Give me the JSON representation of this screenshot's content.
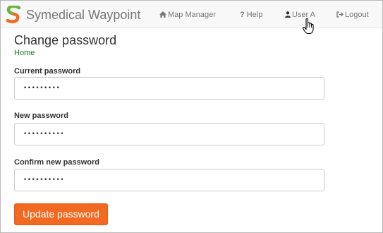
{
  "header": {
    "brand": "Symedical Waypoint",
    "logo_icon": "symedical-s-logo",
    "nav": [
      {
        "label": "Map Manager",
        "icon": "home-icon"
      },
      {
        "label": "Help",
        "icon": "question-icon"
      },
      {
        "label": "User A",
        "icon": "user-icon"
      },
      {
        "label": "Logout",
        "icon": "logout-icon"
      }
    ]
  },
  "page": {
    "title": "Change password",
    "breadcrumb": "Home"
  },
  "form": {
    "current_label": "Current password",
    "current_value": "•••••••••",
    "new_label": "New password",
    "new_value": "••••••••••",
    "confirm_label": "Confirm new password",
    "confirm_value": "••••••••••",
    "submit_label": "Update password"
  },
  "colors": {
    "accent": "#f26a22",
    "breadcrumb": "#1d7a1d",
    "logo_green": "#6cb33f",
    "logo_orange": "#f26a22"
  }
}
